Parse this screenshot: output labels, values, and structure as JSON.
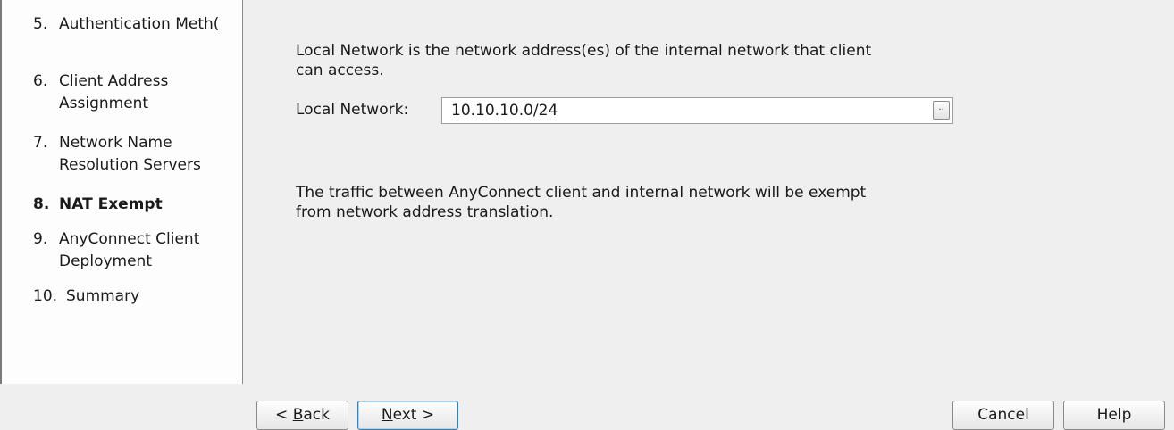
{
  "sidebar": {
    "steps": [
      {
        "num": "5.",
        "label": "Authentication Meth("
      },
      {
        "num": "6.",
        "label": "Client Address Assignment"
      },
      {
        "num": "7.",
        "label": "Network Name Resolution Servers"
      },
      {
        "num": "8.",
        "label": "NAT Exempt"
      },
      {
        "num": "9.",
        "label": "AnyConnect Client Deployment"
      },
      {
        "num": "10.",
        "label": "Summary"
      }
    ],
    "active_step": "8. NAT Exempt"
  },
  "main": {
    "local_network_desc_line1": "Local Network is the network address(es) of the internal network that client",
    "local_network_desc_line2": "can access.",
    "local_network_label": "Local Network:",
    "local_network_value": "10.10.10.0/24",
    "browse_label": "..",
    "exempt_desc_line1": "The traffic between AnyConnect client and internal network will be exempt",
    "exempt_desc_line2": "from network address translation."
  },
  "buttons": {
    "back": {
      "pre": "< ",
      "key": "B",
      "post": "ack"
    },
    "next": {
      "pre": "",
      "key": "N",
      "post": "ext >"
    },
    "cancel": "Cancel",
    "help": "Help"
  }
}
